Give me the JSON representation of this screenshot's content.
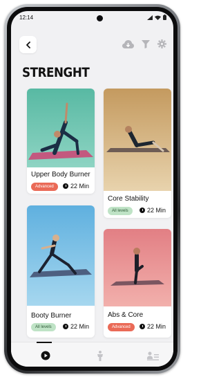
{
  "status_bar": {
    "time": "12:14"
  },
  "page": {
    "title": "STRENGHT"
  },
  "header": {
    "icons": [
      "chevron-left-icon",
      "cloud-download-icon",
      "filter-icon",
      "gear-icon"
    ]
  },
  "workouts": [
    {
      "name": "Upper Body Burner",
      "level": "Advanced",
      "duration": "22 Min"
    },
    {
      "name": "Core Stability",
      "level": "All levels",
      "duration": "22 Min"
    },
    {
      "name": "Booty Burner",
      "level": "All levels",
      "duration": "22 Min"
    },
    {
      "name": "Abs & Core",
      "level": "Advanced",
      "duration": "22 Min"
    }
  ],
  "tabbar": {
    "items": [
      "play-icon",
      "body-icon",
      "profile-list-icon"
    ],
    "active_index": 0
  },
  "colors": {
    "advanced": "#ea6a57",
    "all_levels": "#bfe3c6",
    "screen_bg": "#f1f1f3"
  }
}
